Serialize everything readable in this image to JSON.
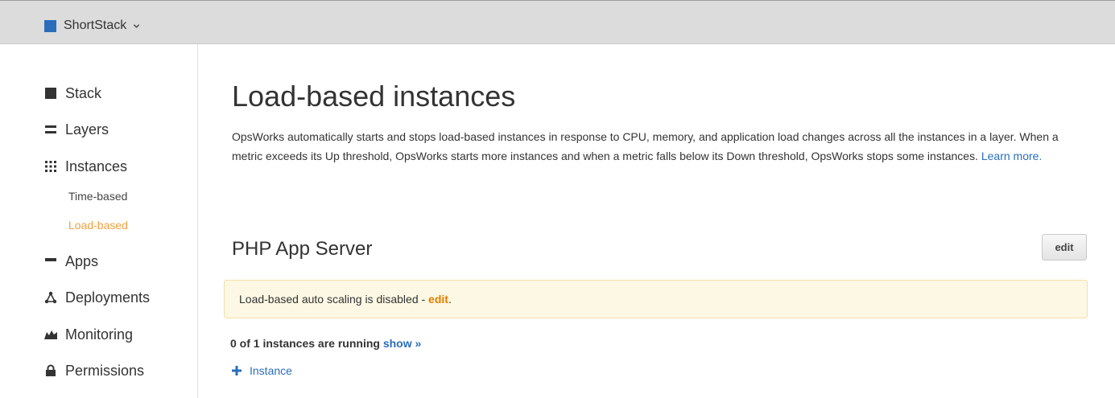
{
  "topbar": {
    "stack_name": "ShortStack",
    "stack_color": "#2a6ebb"
  },
  "sidebar": {
    "items": [
      {
        "label": "Stack",
        "icon": "square-icon"
      },
      {
        "label": "Layers",
        "icon": "layers-icon"
      },
      {
        "label": "Instances",
        "icon": "grid-icon"
      },
      {
        "label": "Apps",
        "icon": "apps-icon"
      },
      {
        "label": "Deployments",
        "icon": "deployments-icon"
      },
      {
        "label": "Monitoring",
        "icon": "monitoring-icon"
      },
      {
        "label": "Permissions",
        "icon": "lock-icon"
      }
    ],
    "subitems": [
      {
        "label": "Time-based",
        "active": false
      },
      {
        "label": "Load-based",
        "active": true
      }
    ],
    "active_color": "#f0a040"
  },
  "main": {
    "title": "Load-based instances",
    "intro": "OpsWorks automatically starts and stops load-based instances in response to CPU, memory, and application load changes across all the instances in a layer. When a metric exceeds its Up threshold, OpsWorks starts more instances and when a metric falls below its Down threshold, OpsWorks stops some instances.",
    "learn_more": "Learn more.",
    "section_title": "PHP App Server",
    "edit_label": "edit",
    "notice_text": "Load-based auto scaling is disabled - ",
    "notice_link": "edit",
    "notice_end": ".",
    "running_text": "0 of 1 instances are running",
    "show_link": "show »",
    "add_instance": "Instance",
    "link_color": "#2a6ebb",
    "notice_bg": "#fcf8e3"
  }
}
